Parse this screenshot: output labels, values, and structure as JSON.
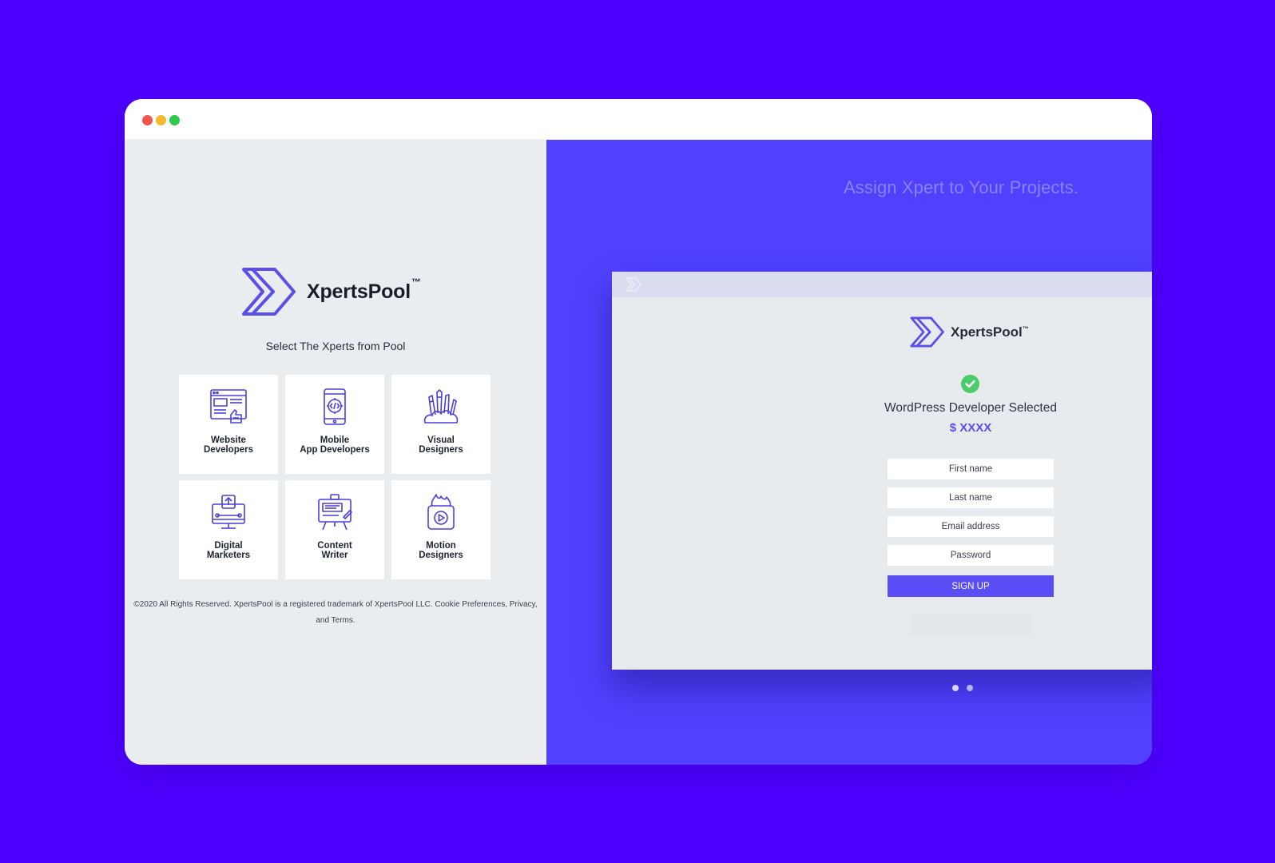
{
  "window": {
    "controls": [
      "close",
      "minimize",
      "maximize"
    ]
  },
  "left_panel": {
    "brand": {
      "name": "XpertsPool",
      "trademark": "™"
    },
    "tagline": "Select The Xperts from Pool",
    "categories": [
      {
        "label": "Website\nDevelopers",
        "icon": "website-icon"
      },
      {
        "label": "Mobile\nApp Developers",
        "icon": "mobile-app-icon"
      },
      {
        "label": "Visual\nDesigners",
        "icon": "design-tools-icon"
      },
      {
        "label": "Digital\nMarketers",
        "icon": "marketing-monitor-icon"
      },
      {
        "label": "Content\nWriter",
        "icon": "content-board-icon"
      },
      {
        "label": "Motion\nDesigners",
        "icon": "motion-video-icon"
      }
    ],
    "footer": "©2020 All Rights Reserved. XpertsPool is a registered trademark of XpertsPool LLC. Cookie Preferences, Privacy, and Terms."
  },
  "right_panel": {
    "heading": "Assign Xpert to Your Projects.",
    "mockup": {
      "brand": {
        "name": "XpertsPool",
        "trademark": "™"
      },
      "selected_title": "WordPress Developer Selected",
      "price": "$ XXXX",
      "fields": {
        "first_name": "First name",
        "last_name": "Last name",
        "email": "Email address",
        "password": "Password"
      },
      "signup_label": "SIGN UP"
    },
    "pager": {
      "count": 2,
      "active_index": 0
    }
  },
  "colors": {
    "background": "#4e00ff",
    "accent": "#5141ff",
    "brand_purple": "#5a4fe8",
    "success": "#4ccb6b"
  }
}
